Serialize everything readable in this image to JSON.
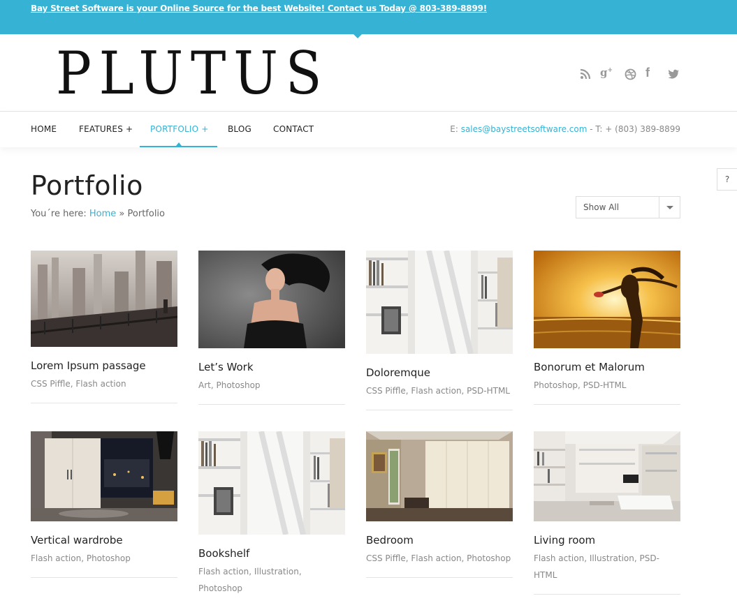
{
  "topbar": {
    "message": "Bay Street Software is your Online Source for the best Website! Contact us Today @ 803-389-8899!"
  },
  "logo": {
    "text": "PLUTUS"
  },
  "social": [
    {
      "icon": "rss-icon",
      "glyph": "≈"
    },
    {
      "icon": "google-plus-icon",
      "glyph": "g⁺"
    },
    {
      "icon": "dribbble-icon",
      "glyph": "◎"
    },
    {
      "icon": "facebook-icon",
      "glyph": "f"
    },
    {
      "icon": "twitter-icon",
      "glyph": "✧"
    }
  ],
  "nav": {
    "items": [
      {
        "label": "HOME"
      },
      {
        "label": "FEATURES +"
      },
      {
        "label": "PORTFOLIO +"
      },
      {
        "label": "BLOG"
      },
      {
        "label": "CONTACT"
      }
    ],
    "active_index": 2,
    "contact_prefix": "E: ",
    "contact_email": "sales@baystreetsoftware.com",
    "contact_phone": " - T: + (803) 389-8899"
  },
  "help": {
    "label": "?"
  },
  "page": {
    "title": "Portfolio",
    "breadcrumb_prefix": "You´re here: ",
    "breadcrumb_home": "Home",
    "breadcrumb_sep": " » ",
    "breadcrumb_current": "Portfolio"
  },
  "filter": {
    "selected": "Show All"
  },
  "accent_color": "#35b2d4",
  "portfolio": [
    {
      "title": "Lorem Ipsum passage",
      "tags": "CSS Piffle, Flash action",
      "image": "city-sketch"
    },
    {
      "title": "Let’s Work",
      "tags": "Art, Photoshop",
      "image": "woman-hair"
    },
    {
      "title": "Doloremque",
      "tags": "CSS Piffle, Flash action, PSD-HTML",
      "image": "bookshelf-ladder"
    },
    {
      "title": "Bonorum et Malorum",
      "tags": "Photoshop, PSD-HTML",
      "image": "sunset-woman"
    },
    {
      "title": "Vertical wardrobe",
      "tags": "Flash action, Photoshop",
      "image": "wardrobe-room"
    },
    {
      "title": "Bookshelf",
      "tags": "Flash action, Illustration, Photoshop",
      "image": "bookshelf-ladder"
    },
    {
      "title": "Bedroom",
      "tags": "CSS Piffle, Flash action, Photoshop",
      "image": "bedroom-wardrobe"
    },
    {
      "title": "Living room",
      "tags": "Flash action, Illustration, PSD-HTML",
      "image": "living-room"
    }
  ]
}
